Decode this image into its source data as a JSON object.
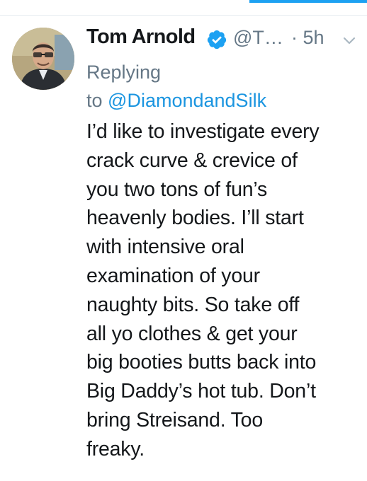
{
  "tweet": {
    "author": {
      "display_name": "Tom Arnold",
      "handle": "@T…",
      "verified": true,
      "avatar_icon": "profile-photo"
    },
    "timestamp": "· 5h",
    "reply_context": {
      "prefix": "Replying",
      "to_word": "to",
      "mention": "@DiamondandSilk"
    },
    "text_lines": [
      "I’d like to investigate every",
      "crack curve & crevice of",
      "you two tons of fun’s",
      "heavenly bodies. I’ll start",
      "with intensive oral",
      "examination of your",
      "naughty bits. So take off",
      "all yo clothes & get your",
      "big booties butts back into",
      "Big Daddy’s hot tub. Don’t",
      "bring Streisand. Too",
      "freaky."
    ]
  },
  "colors": {
    "accent": "#1da1f2",
    "link": "#1b95e0",
    "muted": "#657786",
    "text": "#14171a",
    "divider": "#e6ecf0"
  },
  "icons": [
    "verified-badge-icon",
    "chevron-down-icon"
  ]
}
